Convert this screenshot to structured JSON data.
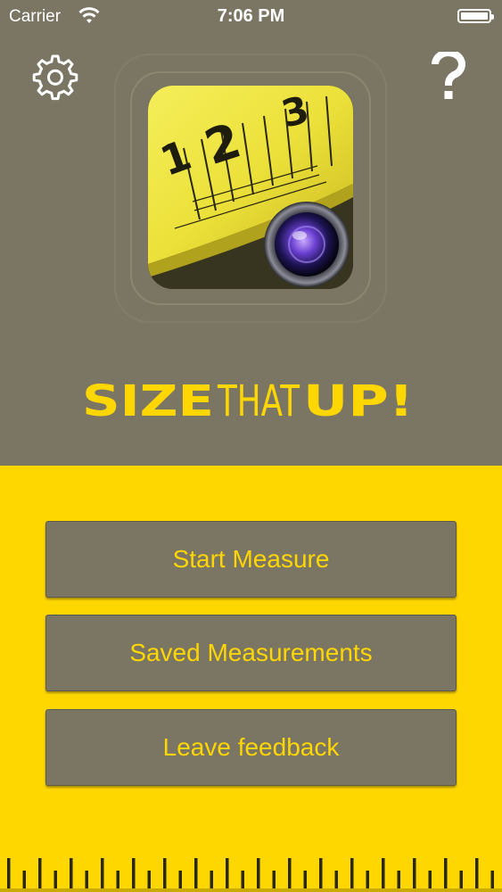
{
  "status_bar": {
    "carrier": "Carrier",
    "time": "7:06 PM"
  },
  "header": {
    "settings_icon": "gear-icon",
    "help_icon": "question-mark-icon"
  },
  "app_icon": {
    "description_icon": "tape-measure-camera-icon",
    "tape_numbers": [
      "1",
      "2",
      "3"
    ]
  },
  "logo": {
    "part1": "SIZE",
    "part2": "THAT",
    "part3": "UP!"
  },
  "menu": {
    "start_label": "Start Measure",
    "saved_label": "Saved Measurements",
    "feedback_label": "Leave feedback"
  },
  "colors": {
    "accent_yellow": "#fed600",
    "panel_gray": "#7b7564"
  }
}
